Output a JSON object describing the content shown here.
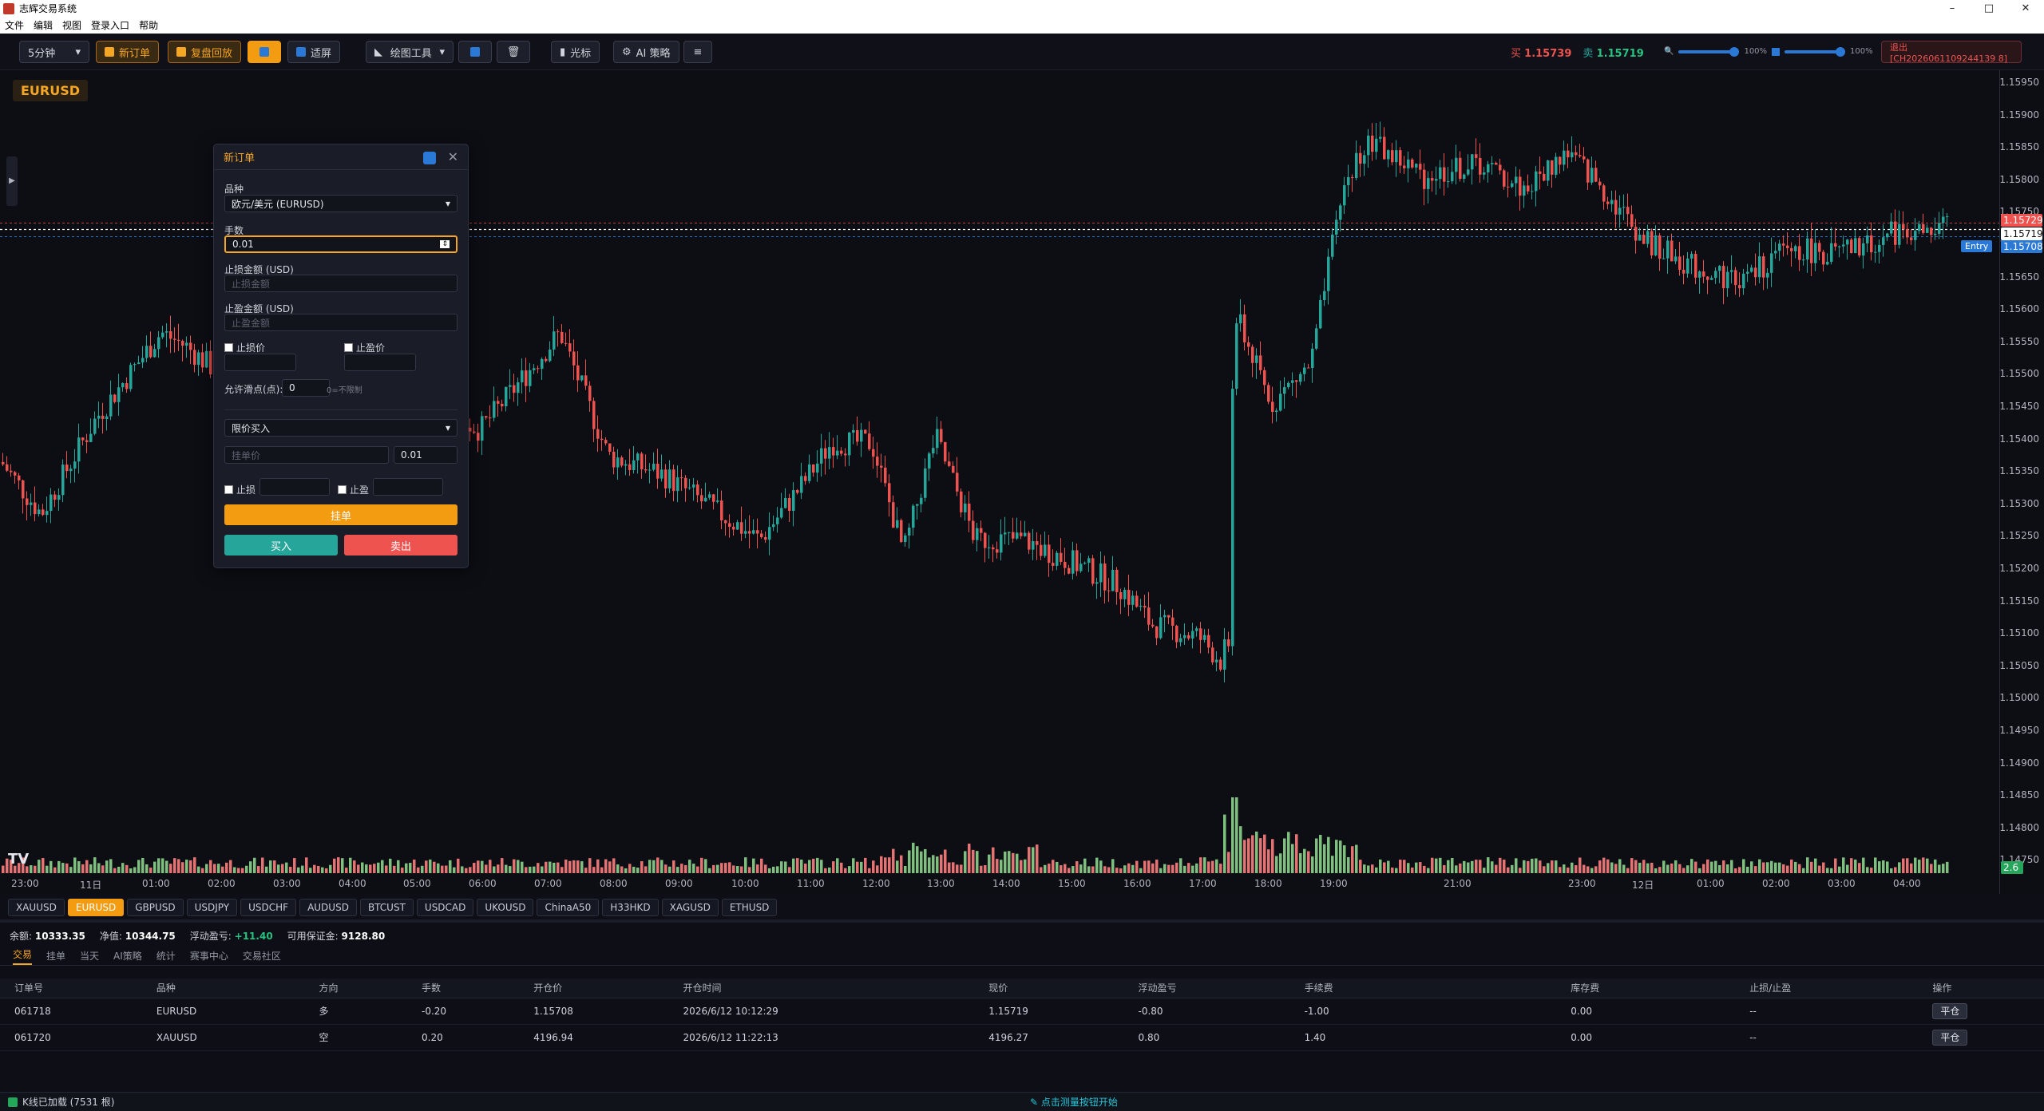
{
  "window": {
    "title": "志辉交易系统",
    "controls": [
      "–",
      "□",
      "✕"
    ]
  },
  "menu": [
    "文件",
    "编辑",
    "视图",
    "登录入口",
    "帮助"
  ],
  "toolbar": {
    "timeframe": "5分钟",
    "new_order": "新订单",
    "replay": "复盘回放",
    "fit_screen": "适屏",
    "drawing_tools": "绘图工具",
    "cursor": "光标",
    "ai_strategy": "AI 策略",
    "buy_label": "买",
    "buy_price": "1.15739",
    "sell_label": "卖",
    "sell_price": "1.15719",
    "zoom1": "100%",
    "zoom2": "100%",
    "logout": "退出 [CH2026061109244139 8]"
  },
  "chart": {
    "symbol": "EURUSD",
    "entry_label": "Entry",
    "price_ask": "1.15729",
    "price_bid": "1.15719",
    "price_entry": "1.15708",
    "volume_tag": "2.6",
    "y_ticks": [
      "1.15950",
      "1.15900",
      "1.15850",
      "1.15800",
      "1.15750",
      "1.15700",
      "1.15650",
      "1.15600",
      "1.15550",
      "1.15500",
      "1.15450",
      "1.15400",
      "1.15350",
      "1.15300",
      "1.15250",
      "1.15200",
      "1.15150",
      "1.15100",
      "1.15050",
      "1.15000",
      "1.14950",
      "1.14900",
      "1.14850",
      "1.14800",
      "1.14750"
    ],
    "x_ticks": [
      "23:00",
      "11日",
      "01:00",
      "02:00",
      "03:00",
      "04:00",
      "05:00",
      "06:00",
      "07:00",
      "08:00",
      "09:00",
      "10:00",
      "11:00",
      "12:00",
      "13:00",
      "14:00",
      "15:00",
      "16:00",
      "17:00",
      "18:00",
      "19:00",
      "21:00",
      "23:00",
      "12日",
      "01:00",
      "02:00",
      "03:00",
      "04:00"
    ],
    "colors": {
      "up": "#26a69a",
      "down": "#ef5350",
      "vol_up": "#7fbf7f",
      "vol_down": "#e57373"
    }
  },
  "symbols": [
    "XAUUSD",
    "EURUSD",
    "GBPUSD",
    "USDJPY",
    "USDCHF",
    "AUDUSD",
    "BTCUST",
    "USDCAD",
    "UKOUSD",
    "ChinaA50",
    "H33HKD",
    "XAGUSD",
    "ETHUSD"
  ],
  "account": {
    "balance_label": "余额:",
    "balance": "10333.35",
    "equity_label": "净值:",
    "equity": "10344.75",
    "pnl_label": "浮动盈亏:",
    "pnl": "+11.40",
    "margin_label": "可用保证金:",
    "margin": "9128.80"
  },
  "tabs": [
    "交易",
    "挂单",
    "当天",
    "AI策略",
    "统计",
    "赛事中心",
    "交易社区"
  ],
  "orders": {
    "headers": [
      "订单号",
      "品种",
      "方向",
      "手数",
      "开仓价",
      "开仓时间",
      "现价",
      "浮动盈亏",
      "手续费",
      "库存费",
      "止损/止盈",
      "操作"
    ],
    "rows": [
      [
        "061718",
        "EURUSD",
        "多",
        "-0.20",
        "1.15708",
        "2026/6/12 10:12:29",
        "1.15719",
        "-0.80",
        "-1.00",
        "0.00",
        "--",
        "平仓"
      ],
      [
        "061720",
        "XAUUSD",
        "空",
        "0.20",
        "4196.94",
        "2026/6/12 11:22:13",
        "4196.27",
        "0.80",
        "1.40",
        "0.00",
        "--",
        "平仓"
      ]
    ]
  },
  "dialog": {
    "title": "新订单",
    "symbol_label": "品种",
    "symbol_value": "欧元/美元 (EURUSD)",
    "lots_label": "手数",
    "lots_value": "0.01",
    "sl_amount_label": "止损金额 (USD)",
    "sl_amount_ph": "止损金额",
    "tp_amount_label": "止盈金额 (USD)",
    "tp_amount_ph": "止盈金额",
    "sl_price": "止损价",
    "tp_price": "止盈价",
    "slippage_label": "允许滑点(点):",
    "slippage_value": "0",
    "slippage_hint": "0=不限制",
    "order_type": "限价买入",
    "pending_price_ph": "挂单价",
    "pending_lots": "0.01",
    "sl": "止损",
    "tp": "止盈",
    "place_order": "挂单",
    "buy": "买入",
    "sell": "卖出"
  },
  "status": {
    "loaded": "K线已加载 (7531 根)",
    "hint": "点击测量按钮开始"
  }
}
